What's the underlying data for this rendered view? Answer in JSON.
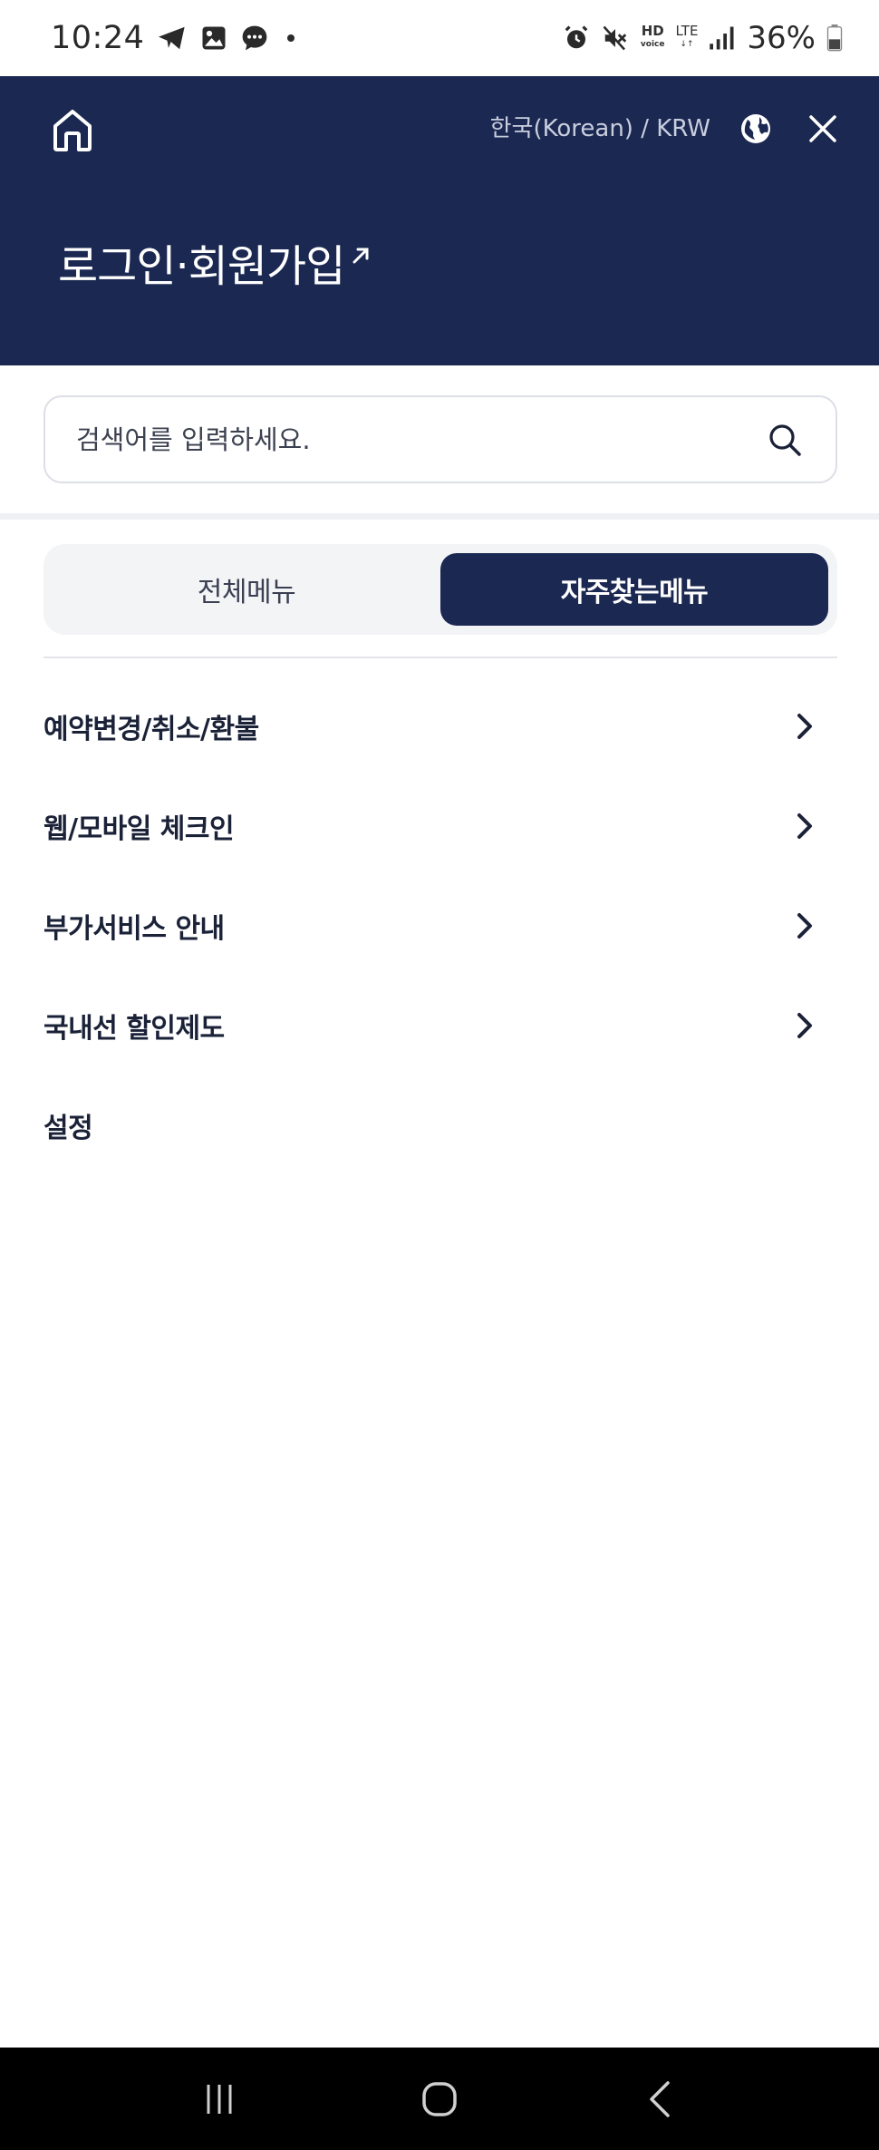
{
  "status_bar": {
    "time": "10:24",
    "battery_text": "36%",
    "hd_label": "HD",
    "hd_sub": "voice",
    "lte_label": "LTE",
    "icons": [
      "telegram-icon",
      "gallery-icon",
      "chat-icon",
      "dot-icon",
      "alarm-icon",
      "mute-icon",
      "signal-icon",
      "battery-icon"
    ]
  },
  "header": {
    "language": "한국(Korean) / KRW",
    "login_label": "로그인·회원가입",
    "bg_color": "#1b2851"
  },
  "search": {
    "placeholder": "검색어를 입력하세요."
  },
  "tabs": [
    {
      "label": "전체메뉴",
      "active": false
    },
    {
      "label": "자주찾는메뉴",
      "active": true
    }
  ],
  "menu": {
    "items": [
      {
        "label": "예약변경/취소/환불",
        "has_chevron": true
      },
      {
        "label": "웹/모바일 체크인",
        "has_chevron": true
      },
      {
        "label": "부가서비스 안내",
        "has_chevron": true
      },
      {
        "label": "국내선 할인제도",
        "has_chevron": true
      },
      {
        "label": "설정",
        "has_chevron": false
      }
    ]
  }
}
